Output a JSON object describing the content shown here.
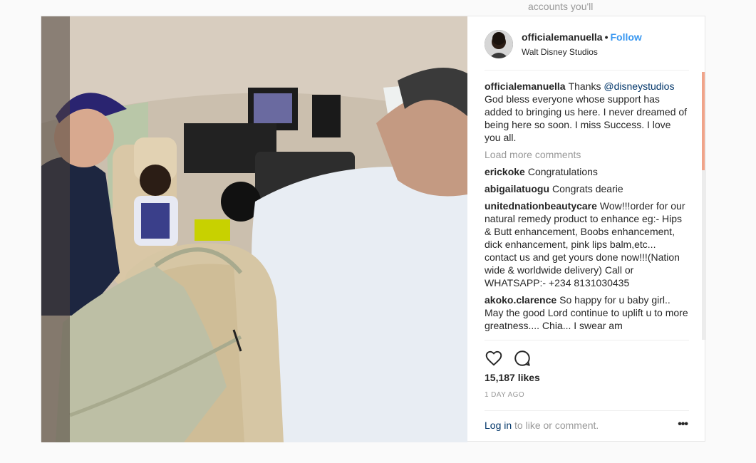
{
  "background": {
    "suggestion_text": "accounts you'll love."
  },
  "post": {
    "header": {
      "username": "officialemanuella",
      "separator": "•",
      "follow_label": "Follow",
      "location": "Walt Disney Studios"
    },
    "caption": {
      "username": "officialemanuella",
      "text_before": "Thanks ",
      "mention": "@disneystudios",
      "text_after": " God bless everyone whose support has added to bringing us here. I never dreamed of being here so soon. I miss Success. I love you all."
    },
    "load_more_label": "Load more comments",
    "comments": [
      {
        "username": "erickoke",
        "text": "Congratulations"
      },
      {
        "username": "abigailatuogu",
        "text": "Congrats dearie"
      },
      {
        "username": "unitednationbeautycare",
        "text": "Wow!!!order for our natural remedy product to enhance eg:- Hips & Butt enhancement, Boobs enhancement, dick enhancement, pink lips balm,etc... contact us and get yours done now!!!(Nation wide & worldwide delivery) Call or WHATSAPP:- +234 8131030435"
      },
      {
        "username": "akoko.clarence",
        "text": "So happy for u baby girl.. May the good Lord continue to uplift u to more greatness.... Chia... I swear am"
      }
    ],
    "likes": "15,187 likes",
    "time": "1 DAY AGO",
    "login_link": "Log in",
    "login_suffix": " to like or comment.",
    "more_icon": "more-horizontal-icon",
    "colors": {
      "accent": "#3897f0",
      "mention": "#003569",
      "muted": "#999999"
    }
  }
}
